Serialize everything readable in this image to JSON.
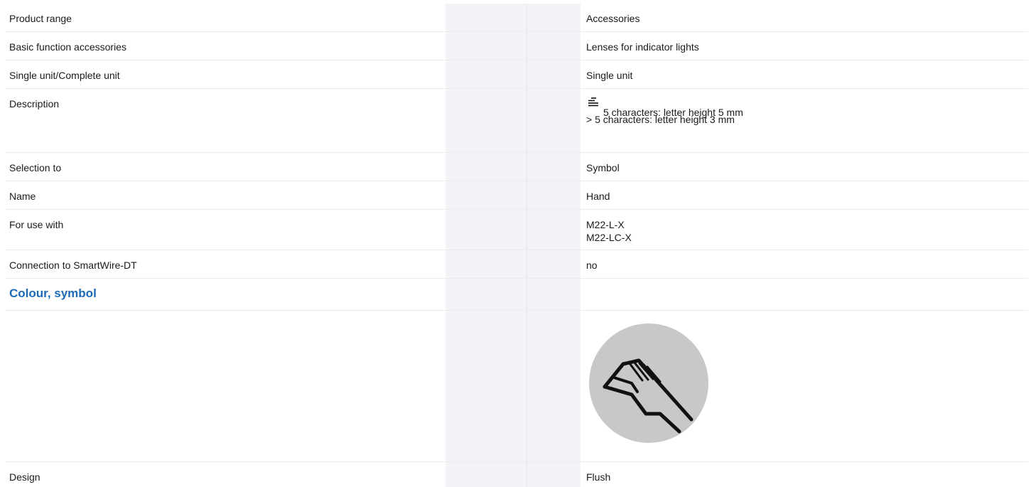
{
  "rows": {
    "product_range": {
      "label": "Product range",
      "value": "Accessories"
    },
    "basic_function": {
      "label": "Basic function accessories",
      "value": "Lenses for indicator lights"
    },
    "unit": {
      "label": "Single unit/Complete unit",
      "value": "Single unit"
    },
    "description": {
      "label": "Description",
      "line1": "5 characters: letter height 5 mm",
      "line2": "> 5 characters: letter height 3 mm",
      "icon": "text-lines-icon"
    },
    "selection": {
      "label": "Selection to",
      "value": "Symbol"
    },
    "name": {
      "label": "Name",
      "value": "Hand"
    },
    "use_with": {
      "label": "For use with",
      "value1": "M22-L-X",
      "value2": "M22-LC-X"
    },
    "smartwire": {
      "label": "Connection to SmartWire-DT",
      "value": "no"
    },
    "design": {
      "label": "Design",
      "value": "Flush"
    }
  },
  "section": {
    "title": "Colour, symbol"
  },
  "symbol": {
    "icon": "hand-symbol-icon",
    "circle_color": "#c8c8c8",
    "stroke_color": "#111111"
  },
  "colors": {
    "accent": "#1d6ab4",
    "column_shade": "#f2f3f6"
  }
}
